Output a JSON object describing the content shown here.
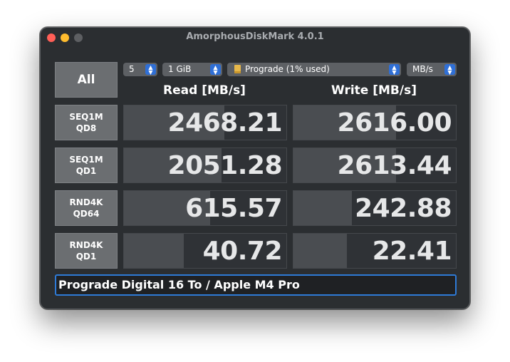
{
  "window": {
    "title": "AmorphousDiskMark 4.0.1",
    "traffic_lights": {
      "close": "#ff5f57",
      "minimize": "#febc2e",
      "maximize": "#5d5f62"
    }
  },
  "controls": {
    "all_label": "All",
    "count": "5",
    "size": "1 GiB",
    "drive": "Prograde (1% used)",
    "unit": "MB/s"
  },
  "headers": {
    "read": "Read [MB/s]",
    "write": "Write [MB/s]"
  },
  "rows": [
    {
      "line1": "SEQ1M",
      "line2": "QD8",
      "read": "2468.21",
      "write": "2616.00",
      "read_fill": 0.62,
      "write_fill": 0.63
    },
    {
      "line1": "SEQ1M",
      "line2": "QD1",
      "read": "2051.28",
      "write": "2613.44",
      "read_fill": 0.6,
      "write_fill": 0.63
    },
    {
      "line1": "RND4K",
      "line2": "QD64",
      "read": "615.57",
      "write": "242.88",
      "read_fill": 0.53,
      "write_fill": 0.36
    },
    {
      "line1": "RND4K",
      "line2": "QD1",
      "read": "40.72",
      "write": "22.41",
      "read_fill": 0.37,
      "write_fill": 0.33
    }
  ],
  "comment": "Prograde Digital 16 To / Apple M4 Pro",
  "colors": {
    "accent": "#2f6fd6",
    "focus_ring": "#2e7ad6"
  }
}
